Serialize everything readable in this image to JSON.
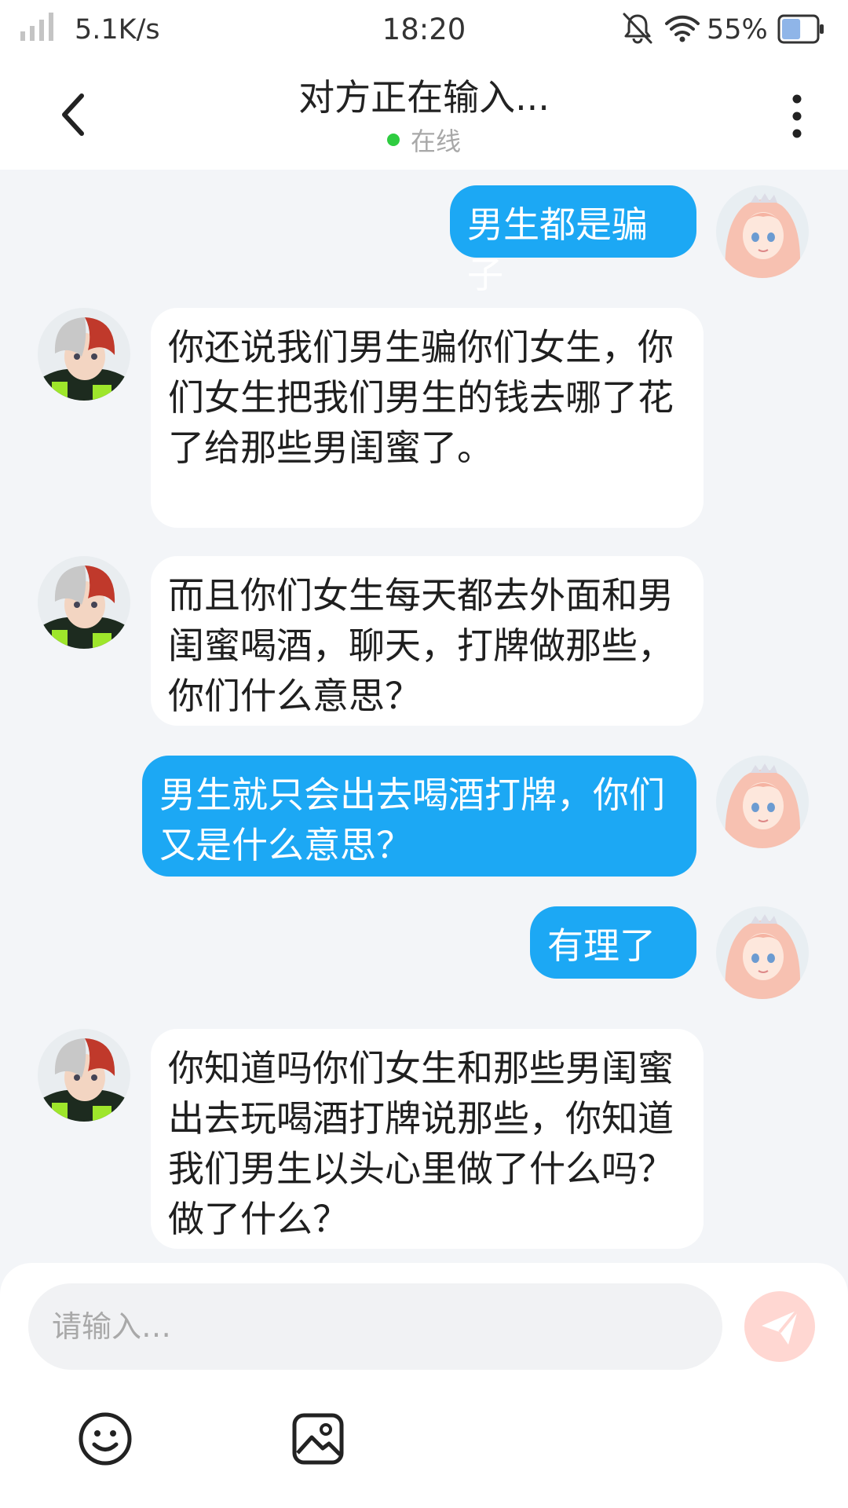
{
  "status_bar": {
    "net_speed": "5.1K/s",
    "time": "18:20",
    "battery_percent": "55%",
    "battery_level": 0.55,
    "icons": [
      "signal-icon",
      "mute-bell-icon",
      "wifi-icon",
      "battery-icon"
    ]
  },
  "header": {
    "title": "对方正在输入...",
    "status": "在线",
    "status_color": "#2ecc40"
  },
  "messages": [
    {
      "from": "me",
      "text": "男生都是骗子"
    },
    {
      "from": "them",
      "text": "你还说我们男生骗你们女生，你们女生把我们男生的钱去哪了花了给那些男闺蜜了。"
    },
    {
      "from": "them",
      "text": "而且你们女生每天都去外面和男闺蜜喝酒，聊天，打牌做那些， 你们什么意思？"
    },
    {
      "from": "me",
      "text": "男生就只会出去喝酒打牌，你们又是什么意思？"
    },
    {
      "from": "me",
      "text": "有理了"
    },
    {
      "from": "them",
      "text": "你知道吗你们女生和那些男闺蜜出去玩喝酒打牌说那些，你知道我们男生以头心里做了什么吗？做了什么？"
    }
  ],
  "composer": {
    "placeholder": "请输入…",
    "value": ""
  },
  "colors": {
    "my_bubble": "#1ca8f4",
    "their_bubble": "#ffffff",
    "chat_background": "#f3f5f8",
    "send_button": "#ffd7d2"
  }
}
